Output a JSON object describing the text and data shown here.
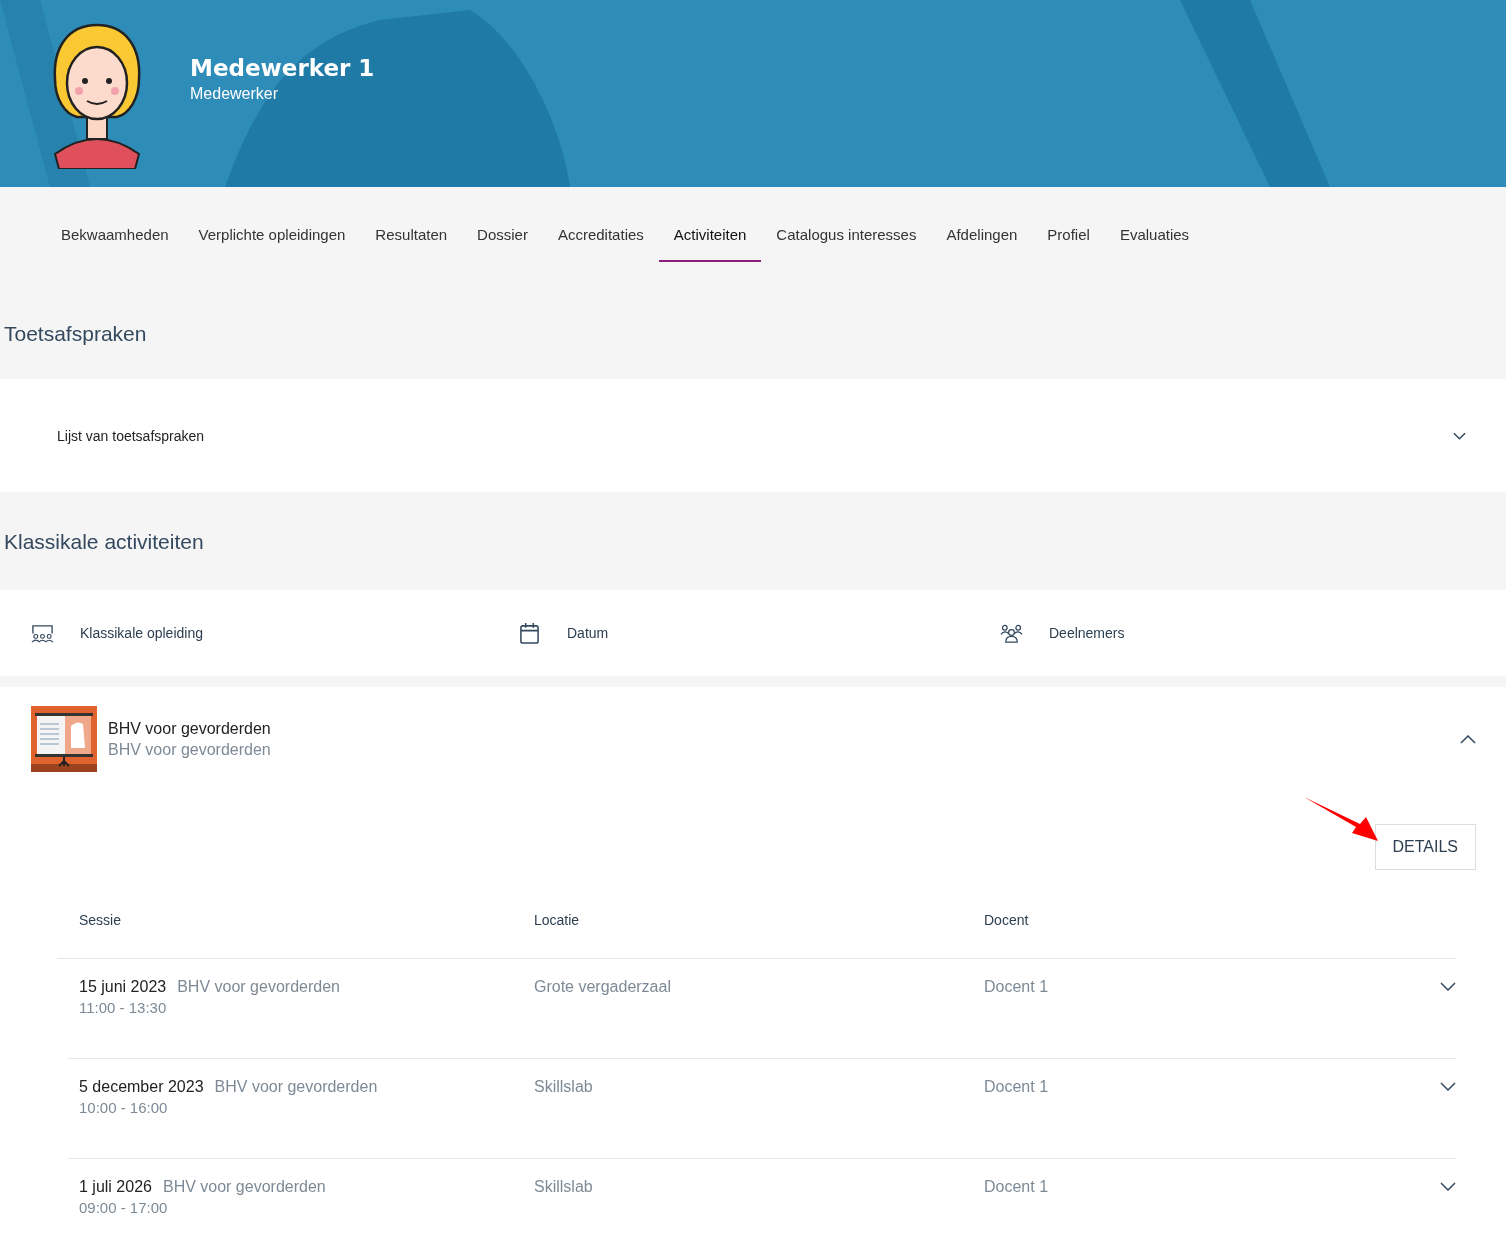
{
  "header": {
    "name": "Medewerker 1",
    "role": "Medewerker"
  },
  "tabs": [
    {
      "label": "Bekwaamheden",
      "selected": false
    },
    {
      "label": "Verplichte opleidingen",
      "selected": false
    },
    {
      "label": "Resultaten",
      "selected": false
    },
    {
      "label": "Dossier",
      "selected": false
    },
    {
      "label": "Accreditaties",
      "selected": false
    },
    {
      "label": "Activiteiten",
      "selected": true
    },
    {
      "label": "Catalogus interesses",
      "selected": false
    },
    {
      "label": "Afdelingen",
      "selected": false
    },
    {
      "label": "Profiel",
      "selected": false
    },
    {
      "label": "Evaluaties",
      "selected": false
    }
  ],
  "toetsafspraken": {
    "title": "Toetsafspraken",
    "panel": {
      "label": "Lijst van toetsafspraken",
      "expanded": false
    }
  },
  "klassikale": {
    "title": "Klassikale activiteiten",
    "columns": [
      {
        "label": "Klassikale opleiding",
        "kind": "classroom"
      },
      {
        "label": "Datum",
        "kind": "calendar"
      },
      {
        "label": "Deelnemers",
        "kind": "people"
      }
    ],
    "activity": {
      "title": "BHV voor gevorderden",
      "subtitle": "BHV voor gevorderden",
      "expanded": true,
      "button": "DETAILS",
      "columns": [
        "Sessie",
        "Locatie",
        "Docent"
      ],
      "rows": [
        {
          "date": "15 juni 2023",
          "name": "BHV voor gevorderden",
          "time": "11:00 - 13:30",
          "location": "Grote vergaderzaal",
          "teacher": "Docent 1",
          "expanded": false
        },
        {
          "date": "5 december 2023",
          "name": "BHV voor gevorderden",
          "time": "10:00 - 16:00",
          "location": "Skillslab",
          "teacher": "Docent 1",
          "expanded": false
        },
        {
          "date": "1 juli 2026",
          "name": "BHV voor gevorderden",
          "time": "09:00 - 17:00",
          "location": "Skillslab",
          "teacher": "Docent 1",
          "expanded": false
        }
      ]
    }
  }
}
